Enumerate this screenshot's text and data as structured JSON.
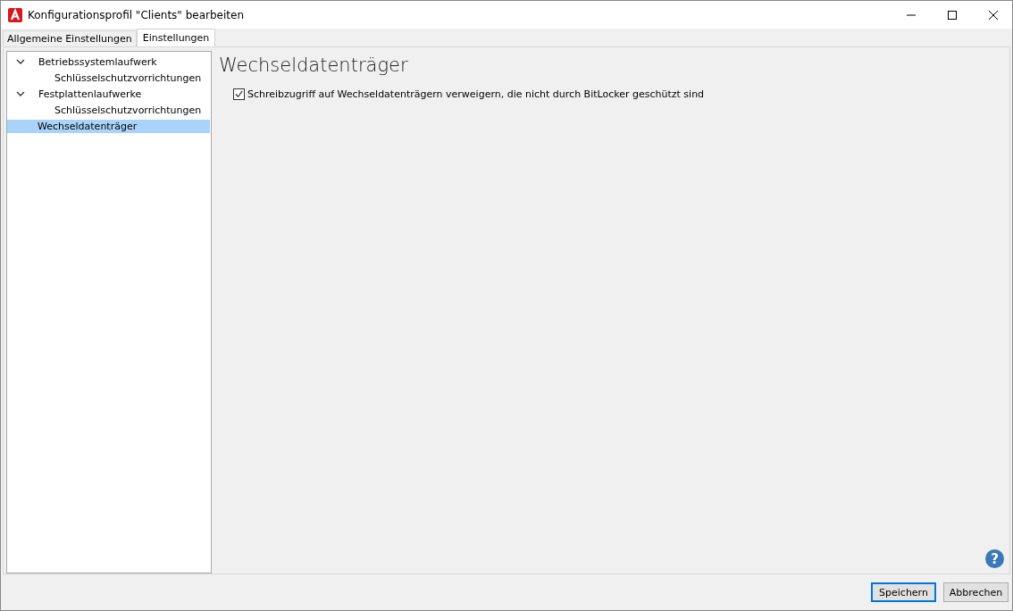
{
  "window": {
    "title": "Konfigurationsprofil \"Clients\" bearbeiten"
  },
  "tabs": [
    {
      "label": "Allgemeine Einstellungen",
      "selected": false
    },
    {
      "label": "Einstellungen",
      "selected": true
    }
  ],
  "tree": [
    {
      "label": "Betriebssystemlaufwerk",
      "expanded": true,
      "selected": false,
      "children": [
        {
          "label": "Schlüsselschutzvorrichtungen",
          "selected": false
        }
      ]
    },
    {
      "label": "Festplattenlaufwerke",
      "expanded": true,
      "selected": false,
      "children": [
        {
          "label": "Schlüsselschutzvorrichtungen",
          "selected": false
        }
      ]
    },
    {
      "label": "Wechseldatenträger",
      "selected": true
    }
  ],
  "panel": {
    "heading": "Wechseldatenträger",
    "options": [
      {
        "label": "Schreibzugriff auf Wechseldatenträgern verweigern, die nicht durch BitLocker geschützt sind",
        "checked": true
      }
    ],
    "help": "?"
  },
  "buttons": [
    {
      "label": "Speichern",
      "default": true
    },
    {
      "label": "Abbrechen",
      "default": false
    }
  ]
}
